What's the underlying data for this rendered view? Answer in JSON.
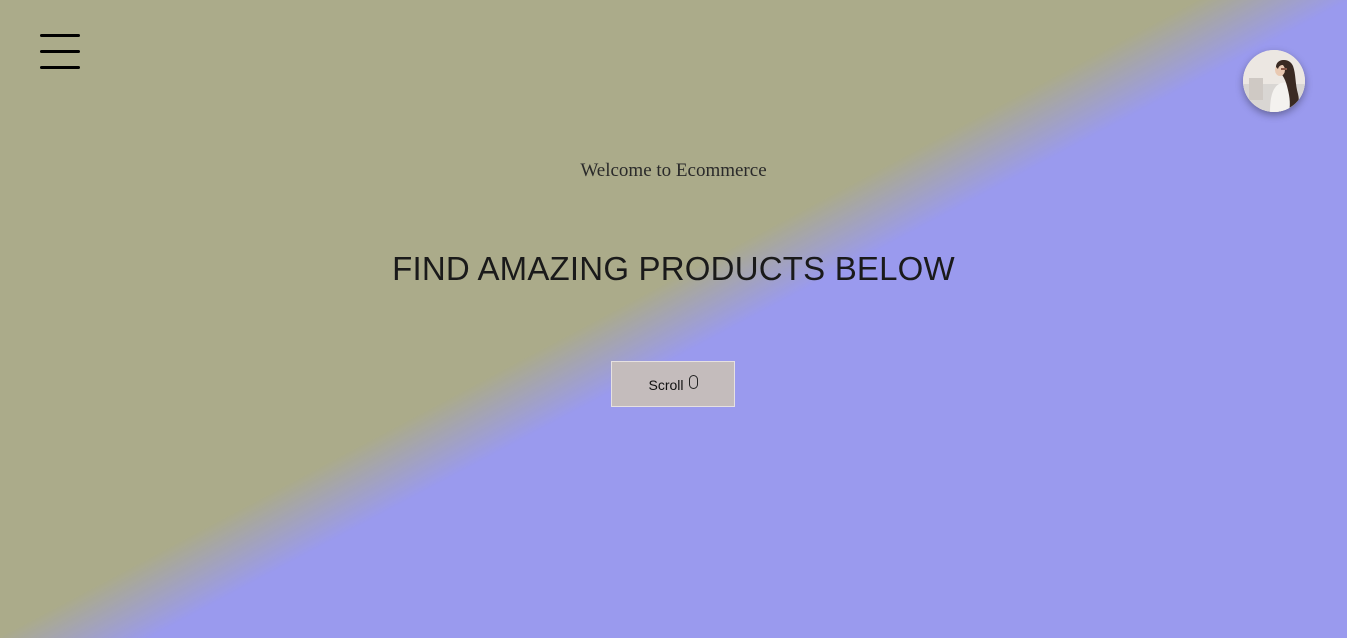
{
  "hero": {
    "welcome_text": "Welcome to Ecommerce",
    "headline": "FIND AMAZING PRODUCTS BELOW",
    "scroll_button": {
      "label": "Scroll",
      "icon": "mouse-icon"
    }
  },
  "header": {
    "menu_icon": "hamburger-menu-icon",
    "avatar_icon": "user-avatar"
  },
  "colors": {
    "gradient_left": "#abab8a",
    "gradient_right": "#9a9aee",
    "button_bg": "#c4bcbc"
  }
}
